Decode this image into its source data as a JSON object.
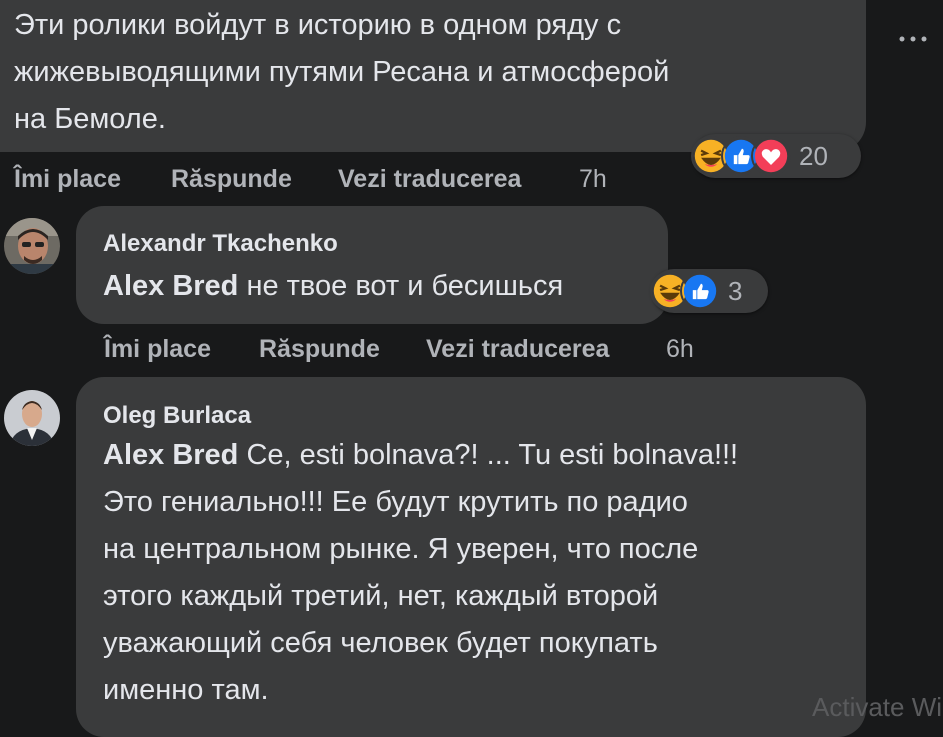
{
  "comment1": {
    "text_line1": "Эти ролики войдут в историю в одном ряду с",
    "text_line2": "жижевыводящими путями Ресана и атмосферой",
    "text_line3": "на Бемоле.",
    "reaction_count": "20",
    "actions": {
      "like": "Îmi place",
      "reply": "Răspunde",
      "translate": "Vezi traducerea",
      "time": "7h"
    }
  },
  "comment2": {
    "author": "Alexandr Tkachenko",
    "mention": "Alex Bred",
    "text": " не твое вот и бесишься",
    "reaction_count": "3",
    "actions": {
      "like": "Îmi place",
      "reply": "Răspunde",
      "translate": "Vezi traducerea",
      "time": "6h"
    }
  },
  "comment3": {
    "author": "Oleg Burlaca",
    "mention": "Alex Bred",
    "line1_rest": " Ce, esti bolnava?! ... Tu esti bolnava!!!",
    "line2": "Это гениально!!! Ее будут крутить по радио",
    "line3": "на центральном рынке. Я уверен, что после",
    "line4": "этого каждый третий, нет, каждый второй",
    "line5": "уважающий себя человек будет покупать",
    "line6": "именно там."
  },
  "watermark": "Activate Wi",
  "icons": {
    "more": "more-horizontal-icon",
    "haha": "haha-reaction-icon",
    "like": "like-reaction-icon",
    "love": "love-reaction-icon"
  },
  "colors": {
    "background": "#18191a",
    "bubble": "#3a3b3c",
    "text": "#e4e6eb",
    "secondary": "#b0b3b8",
    "like_blue": "#1877f2",
    "love_red": "#f33e58",
    "haha_yellow": "#f7b125"
  }
}
